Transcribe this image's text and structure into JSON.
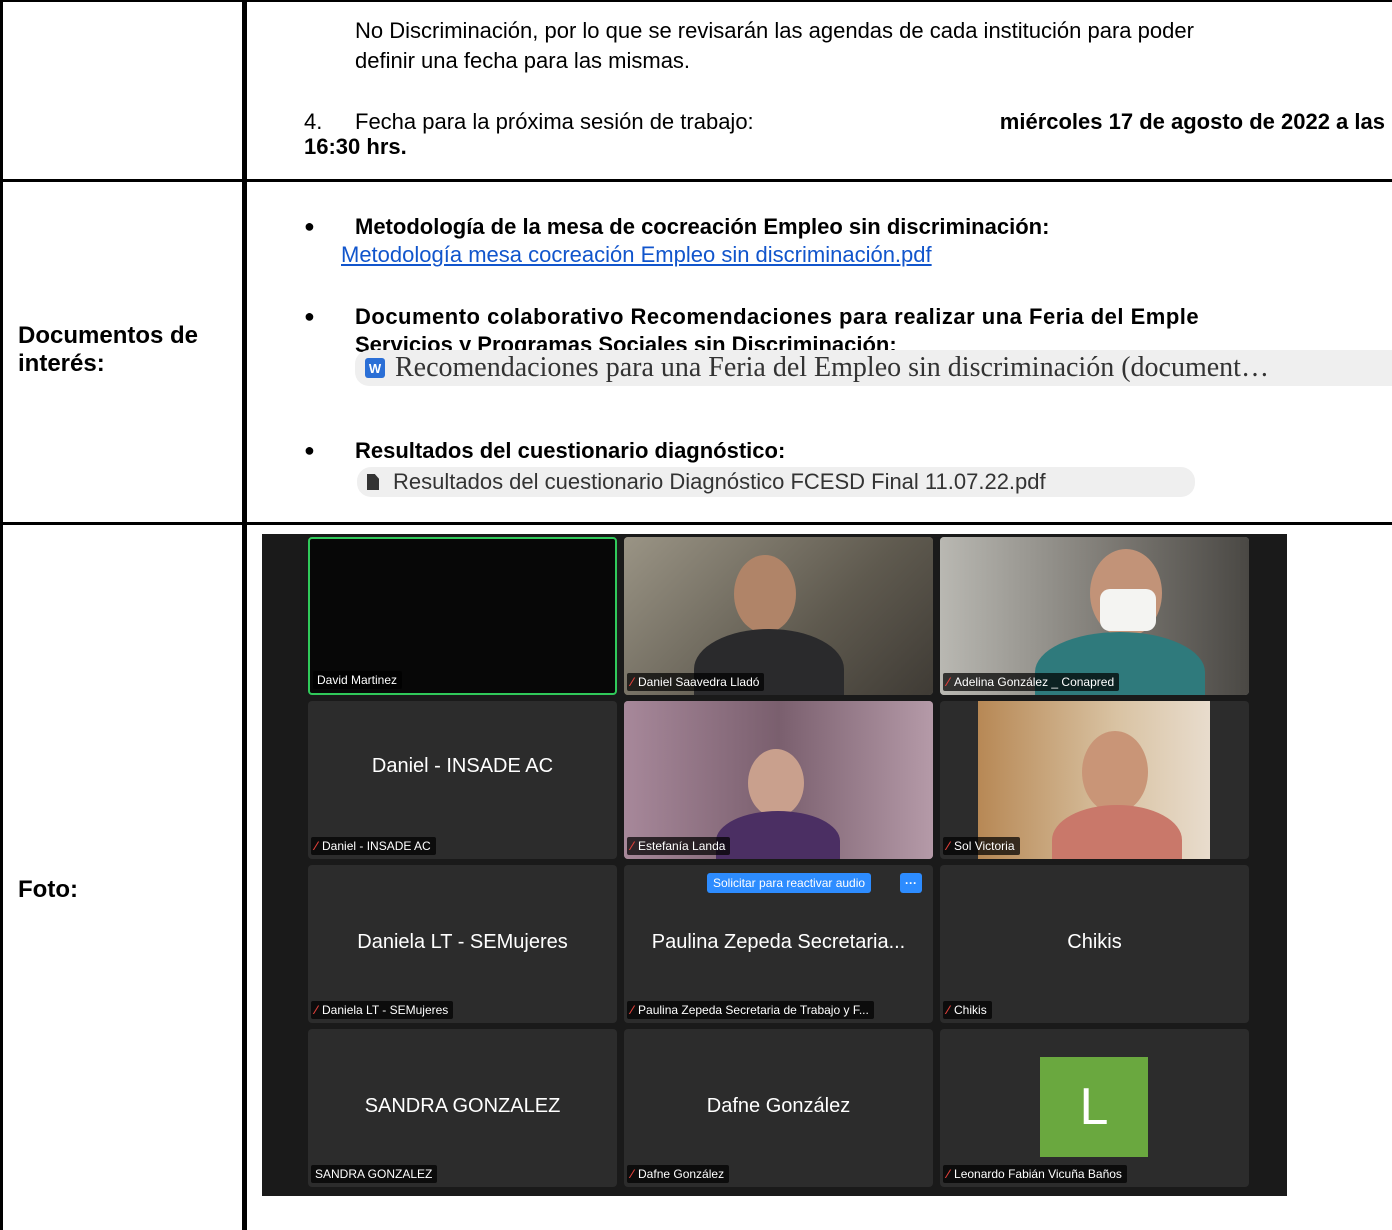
{
  "row1": {
    "para_line1": "No Discriminación, por lo que se revisarán las agendas de cada institución para poder",
    "para_line2": "definir una fecha para las mismas.",
    "item4_number": "4.",
    "item4_text": "Fecha para la próxima sesión de trabajo: ",
    "item4_bold_line1": "miércoles 17 de agosto de 2022 a las",
    "item4_bold_line2": "16:30 hrs."
  },
  "row2": {
    "label_line1": "Documentos de",
    "label_line2": "interés:",
    "bullet": "●",
    "b1_title": "Metodología de la mesa de cocreación Empleo sin discriminación:",
    "b1_link": "Metodología mesa cocreación Empleo sin discriminación.pdf",
    "b2_title_line1": "Documento colaborativo Recomendaciones para realizar una Feria del Emple",
    "b2_title_line2": "Servicios y Programas Sociales sin Discriminación:",
    "b2_chip_icon": "W",
    "b2_chip": "Recomendaciones para una Feria del Empleo sin discriminación (document…",
    "b3_title": "Resultados del cuestionario diagnóstico:",
    "b3_chip": "Resultados del cuestionario Diagnóstico FCESD Final 11.07.22.pdf"
  },
  "row3": {
    "label": "Foto:",
    "zoom": {
      "mic_glyph": "⁄",
      "tiles": [
        {
          "label": "David Martinez"
        },
        {
          "label": "Daniel Saavedra Lladó"
        },
        {
          "label": "Adelina González _ Conapred"
        },
        {
          "name": "Daniel - INSADE AC",
          "label": "Daniel - INSADE AC"
        },
        {
          "label": "Estefanía Landa"
        },
        {
          "label": "Sol Victoria"
        },
        {
          "name": "Daniela LT - SEMujeres",
          "label": "Daniela LT - SEMujeres"
        },
        {
          "name": "Paulina Zepeda Secretaria...",
          "label": "Paulina Zepeda Secretaria de Trabajo y F...",
          "request_button": "Solicitar para reactivar audio",
          "more_button": "···"
        },
        {
          "name": "Chikis",
          "label": "Chikis"
        },
        {
          "name": "SANDRA GONZALEZ",
          "label": "SANDRA GONZALEZ"
        },
        {
          "name": "Dafne González",
          "label": "Dafne González"
        },
        {
          "avatar_letter": "L",
          "label": "Leonardo Fabián Vicuña Baños"
        }
      ]
    }
  }
}
